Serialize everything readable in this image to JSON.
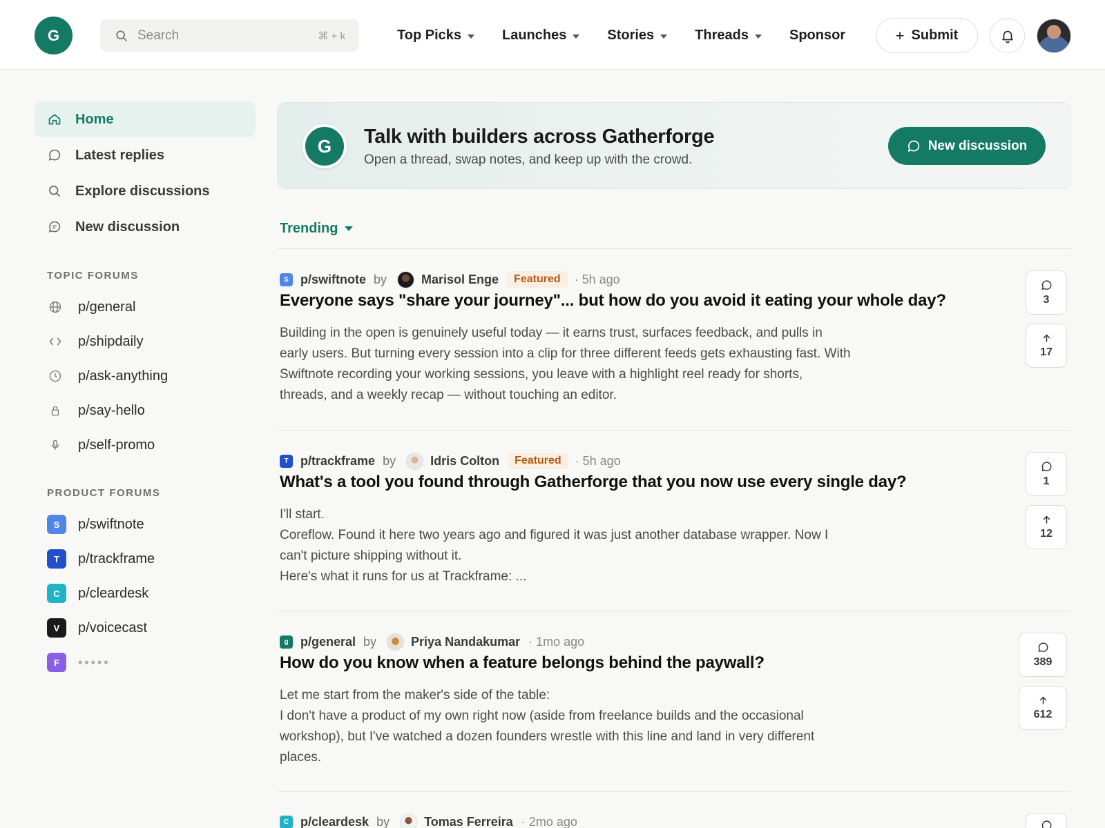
{
  "header": {
    "logo_letter": "G",
    "search_placeholder": "Search",
    "search_shortcut": "⌘ + k",
    "nav": [
      {
        "label": "Top Picks",
        "dropdown": true
      },
      {
        "label": "Launches",
        "dropdown": true
      },
      {
        "label": "Stories",
        "dropdown": true
      },
      {
        "label": "Threads",
        "dropdown": true
      },
      {
        "label": "Sponsor",
        "dropdown": false
      }
    ],
    "submit_label": "Submit"
  },
  "sidebar": {
    "main": [
      {
        "label": "Home",
        "icon": "home-icon",
        "active": true
      },
      {
        "label": "Latest replies",
        "icon": "chat-bubble-icon"
      },
      {
        "label": "Explore discussions",
        "icon": "search-icon"
      },
      {
        "label": "New discussion",
        "icon": "chat-lines-icon"
      }
    ],
    "topic_title": "TOPIC FORUMS",
    "topics": [
      {
        "label": "p/general",
        "icon": "globe-icon"
      },
      {
        "label": "p/shipdaily",
        "icon": "code-icon"
      },
      {
        "label": "p/ask-anything",
        "icon": "clock-icon"
      },
      {
        "label": "p/say-hello",
        "icon": "lock-icon"
      },
      {
        "label": "p/self-promo",
        "icon": "microphone-icon"
      }
    ],
    "product_title": "PRODUCT FORUMS",
    "products": [
      {
        "label": "p/swiftnote",
        "letter": "S",
        "color": "#4f86e8"
      },
      {
        "label": "p/trackframe",
        "letter": "T",
        "color": "#1f4fc9"
      },
      {
        "label": "p/cleardesk",
        "letter": "C",
        "color": "#1fb3c8"
      },
      {
        "label": "p/voicecast",
        "letter": "V",
        "color": "#1a1a1a"
      },
      {
        "label": "•••••",
        "letter": "F",
        "color": "#8b5ee8"
      }
    ]
  },
  "banner": {
    "logo_letter": "G",
    "title": "Talk with builders across Gatherforge",
    "subtitle": "Open a thread, swap notes, and keep up with the crowd.",
    "button_label": "New discussion"
  },
  "sort_label": "Trending",
  "posts": [
    {
      "forum": "p/swiftnote",
      "forum_letter": "S",
      "forum_color": "#4f86e8",
      "by": "by",
      "author": "Marisol Enge",
      "featured": "Featured",
      "time": "· 5h ago",
      "title": "Everyone says \"share your journey\"... but how do you avoid it eating your whole day?",
      "body": "Building in the open is genuinely useful today — it earns trust, surfaces feedback, and pulls in early users. But turning every session into a clip for three different feeds gets exhausting fast. With Swiftnote recording your working sessions, you leave with a highlight reel ready for shorts, threads, and a weekly recap — without touching an editor.",
      "comments": "3",
      "upvotes": "17"
    },
    {
      "forum": "p/trackframe",
      "forum_letter": "T",
      "forum_color": "#1f4fc9",
      "by": "by",
      "author": "Idris Colton",
      "featured": "Featured",
      "time": "· 5h ago",
      "title": "What's a tool you found through Gatherforge that you now use every single day?",
      "body": "I'll start.\nCoreflow. Found it here two years ago and figured it was just another database wrapper. Now I can't picture shipping without it.\nHere's what it runs for us at Trackframe: ...",
      "comments": "1",
      "upvotes": "12"
    },
    {
      "forum": "p/general",
      "forum_letter": "g",
      "forum_color": "#147a63",
      "by": "by",
      "author": "Priya Nandakumar",
      "featured": "",
      "time": "· 1mo ago",
      "title": "How do you know when a feature belongs behind the paywall?",
      "body": "Let me start from the maker's side of the table:\nI don't have a product of my own right now (aside from freelance builds and the occasional workshop), but I've watched a dozen founders wrestle with this line and land in very different places.",
      "comments": "389",
      "upvotes": "612"
    },
    {
      "forum": "p/cleardesk",
      "forum_letter": "C",
      "forum_color": "#1fb3c8",
      "by": "by",
      "author": "Tomas Ferreira",
      "featured": "",
      "time": "· 2mo ago",
      "title": "",
      "body": "",
      "comments": "",
      "upvotes": ""
    }
  ]
}
